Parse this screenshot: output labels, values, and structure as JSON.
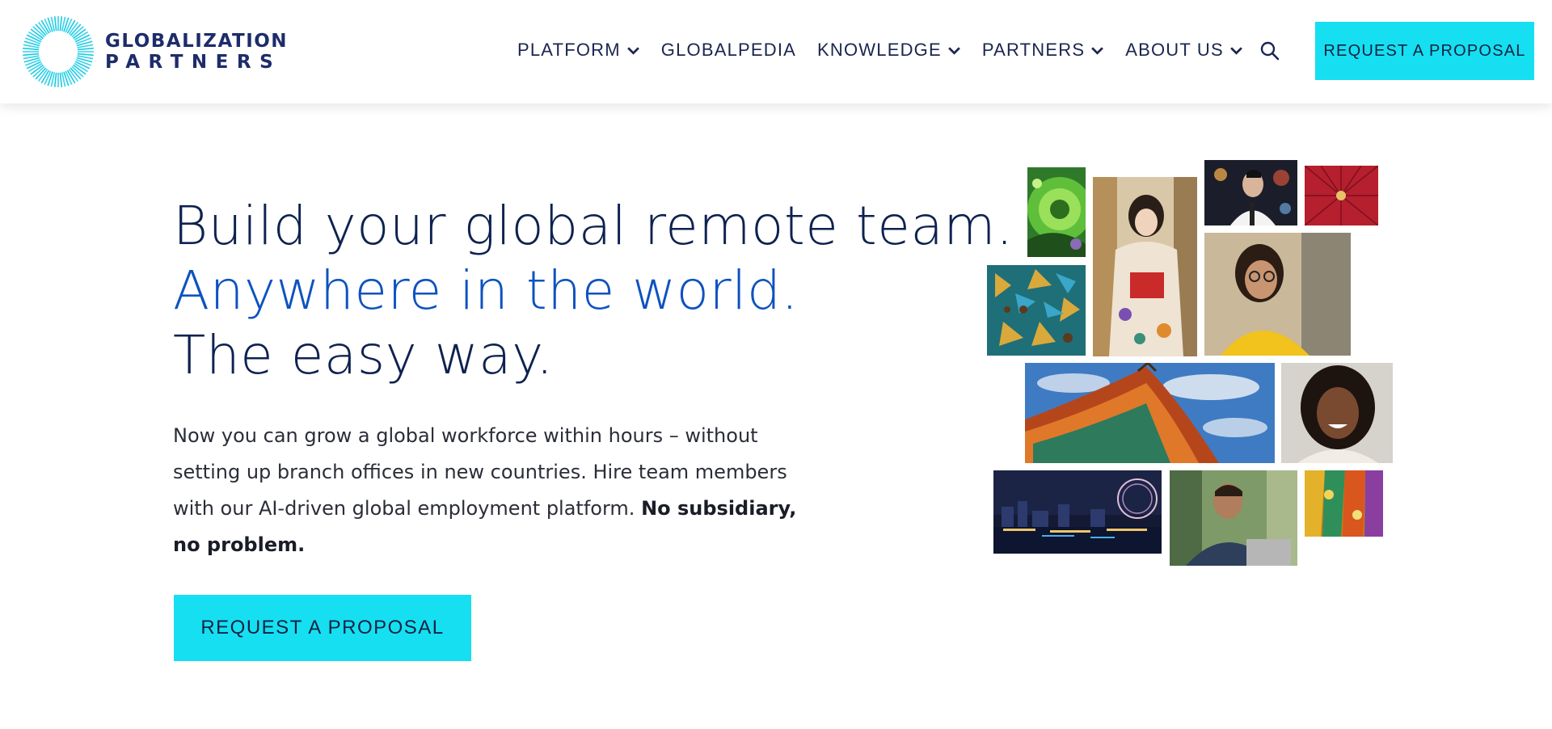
{
  "header": {
    "logo": {
      "line1": "GLOBALIZATION",
      "line2": "PARTNERS",
      "icon": "sunburst-ring-logo"
    },
    "nav": [
      {
        "label": "PLATFORM",
        "has_dropdown": true
      },
      {
        "label": "GLOBALPEDIA",
        "has_dropdown": false
      },
      {
        "label": "KNOWLEDGE",
        "has_dropdown": true
      },
      {
        "label": "PARTNERS",
        "has_dropdown": true
      },
      {
        "label": "ABOUT US",
        "has_dropdown": true
      }
    ],
    "search_icon": "search-icon",
    "cta": "REQUEST A PROPOSAL"
  },
  "hero": {
    "headline_line1": "Build your global remote team.",
    "headline_line2": "Anywhere in the world.",
    "headline_line3": "The easy way.",
    "body_regular": "Now you can grow a global workforce within hours – without setting up branch offices in new countries. Hire team members with our AI-driven global employment platform. ",
    "body_bold": "No subsidiary, no problem.",
    "cta": "REQUEST A PROPOSAL"
  },
  "collage": {
    "images": [
      "green-stained-glass-dome",
      "woman-in-kimono",
      "man-on-phone-at-night",
      "red-paper-umbrella",
      "mosaic-tiles",
      "woman-with-glasses-yellow-sweater",
      "asian-temple-roof",
      "smiling-woman",
      "city-skyline-at-night",
      "man-with-laptop",
      "colorful-fabrics"
    ]
  },
  "colors": {
    "accent": "#16dff2",
    "navy": "#0e2250",
    "blue": "#0d52c0",
    "logo": "#1e2c6b"
  }
}
